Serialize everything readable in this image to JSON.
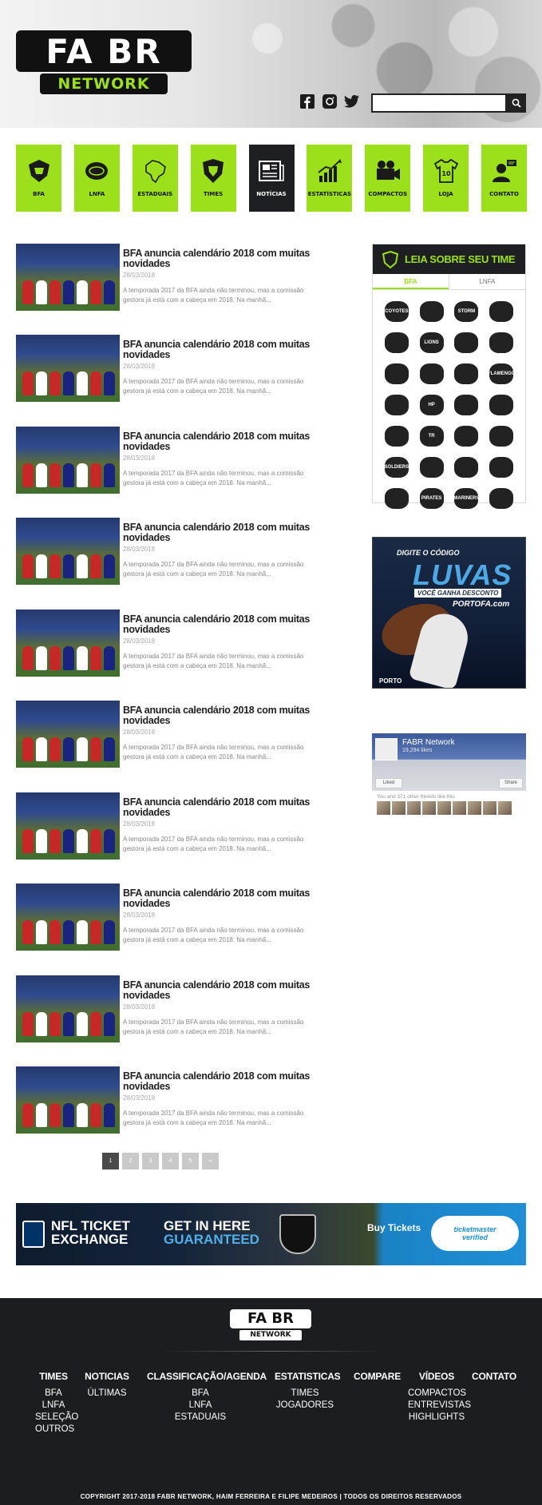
{
  "header": {
    "logo_top": "FA BR",
    "logo_bottom": "NETWORK",
    "search": {
      "value": "",
      "placeholder": ""
    },
    "social": [
      "facebook-icon",
      "instagram-icon",
      "twitter-icon"
    ]
  },
  "nav": [
    {
      "label": "BFA",
      "icon": "bfa-shield-icon"
    },
    {
      "label": "LNFA",
      "icon": "lnfa-helmet-icon"
    },
    {
      "label": "ESTADUAIS",
      "icon": "brazil-map-icon"
    },
    {
      "label": "TIMES",
      "icon": "team-shield-icon"
    },
    {
      "label": "NOTÍCIAS",
      "icon": "newspaper-icon",
      "active": true
    },
    {
      "label": "ESTATÍSTICAS",
      "icon": "bar-chart-icon"
    },
    {
      "label": "COMPACTOS",
      "icon": "video-camera-icon"
    },
    {
      "label": "LOJA",
      "icon": "jersey-icon"
    },
    {
      "label": "CONTATO",
      "icon": "contact-person-icon"
    }
  ],
  "news": [
    {
      "title": "BFA anuncia calendário 2018 com muitas novidades",
      "date": "28/03/2018",
      "excerpt": "A temporada 2017 da BFA ainda não terminou, mas a comissão gestora já está com a cabeça em 2018. Na manhã..."
    },
    {
      "title": "BFA anuncia calendário 2018 com muitas novidades",
      "date": "28/03/2018",
      "excerpt": "A temporada 2017 da BFA ainda não terminou, mas a comissão gestora já está com a cabeça em 2018. Na manhã..."
    },
    {
      "title": "BFA anuncia calendário 2018 com muitas novidades",
      "date": "28/03/2018",
      "excerpt": "A temporada 2017 da BFA ainda não terminou, mas a comissão gestora já está com a cabeça em 2018. Na manhã..."
    },
    {
      "title": "BFA anuncia calendário 2018 com muitas novidades",
      "date": "28/03/2018",
      "excerpt": "A temporada 2017 da BFA ainda não terminou, mas a comissão gestora já está com a cabeça em 2018. Na manhã..."
    },
    {
      "title": "BFA anuncia calendário 2018 com muitas novidades",
      "date": "28/03/2018",
      "excerpt": "A temporada 2017 da BFA ainda não terminou, mas a comissão gestora já está com a cabeça em 2018. Na manhã..."
    },
    {
      "title": "BFA anuncia calendário 2018 com muitas novidades",
      "date": "28/03/2018",
      "excerpt": "A temporada 2017 da BFA ainda não terminou, mas a comissão gestora já está com a cabeça em 2018. Na manhã..."
    },
    {
      "title": "BFA anuncia calendário 2018 com muitas novidades",
      "date": "28/03/2018",
      "excerpt": "A temporada 2017 da BFA ainda não terminou, mas a comissão gestora já está com a cabeça em 2018. Na manhã..."
    },
    {
      "title": "BFA anuncia calendário 2018 com muitas novidades",
      "date": "28/03/2018",
      "excerpt": "A temporada 2017 da BFA ainda não terminou, mas a comissão gestora já está com a cabeça em 2018. Na manhã..."
    },
    {
      "title": "BFA anuncia calendário 2018 com muitas novidades",
      "date": "28/03/2018",
      "excerpt": "A temporada 2017 da BFA ainda não terminou, mas a comissão gestora já está com a cabeça em 2018. Na manhã..."
    },
    {
      "title": "BFA anuncia calendário 2018 com muitas novidades",
      "date": "28/03/2018",
      "excerpt": "A temporada 2017 da BFA ainda não terminou, mas a comissão gestora já está com a cabeça em 2018. Na manhã..."
    }
  ],
  "pagination": {
    "pages": [
      "1",
      "2",
      "3",
      "4",
      "5",
      "»"
    ],
    "current": "1"
  },
  "sidebar": {
    "team_box": {
      "title": "LEIA SOBRE SEU TIME",
      "tabs": [
        "BFA",
        "LNFA"
      ],
      "active_tab": "BFA",
      "team_logos": [
        "COYOTES",
        "",
        "STORM",
        "",
        "",
        "LIONS",
        "",
        "",
        "",
        "",
        "",
        "FLAMENGO",
        "",
        "HP",
        "",
        "",
        "",
        "TR",
        "",
        "",
        "SOLDIERS",
        "",
        "",
        "",
        "",
        "PIRATES",
        "MARINERS",
        ""
      ]
    },
    "ad": {
      "line1": "DIGITE O CÓDIGO",
      "code": "LUVAS",
      "line2": "VOCÊ GANHA DESCONTO",
      "site": "PORTOFA.com",
      "brand": "PORTO"
    },
    "facebook": {
      "page_name": "FABR Network",
      "likes": "19,294 likes",
      "liked_label": "Liked",
      "share_label": "Share",
      "friends_text": "You and 371 other friends like this"
    }
  },
  "bottom_ad": {
    "left_line1": "NFL TICKET",
    "left_line2": "EXCHANGE",
    "mid_line1": "GET IN HERE",
    "mid_line2": "GUARANTEED",
    "button": "Buy Tickets",
    "badge_line1": "ticketmaster",
    "badge_line2": "verified"
  },
  "footer": {
    "logo_top": "FA BR",
    "logo_bottom": "NETWORK",
    "columns": [
      {
        "heading": "TIMES",
        "items": [
          "BFA",
          "LNFA",
          "SELEÇÃO",
          "OUTROS"
        ]
      },
      {
        "heading": "NOTICIAS",
        "items": [
          "ÚLTIMAS"
        ]
      },
      {
        "heading": "CLASSIFICAÇÃO/AGENDA",
        "items": [
          "BFA",
          "LNFA",
          "ESTADUAIS"
        ]
      },
      {
        "heading": "ESTATISTICAS",
        "items": [
          "TIMES",
          "JOGADORES"
        ]
      },
      {
        "heading": "COMPARE",
        "items": []
      },
      {
        "heading": "VÍDEOS",
        "items": [
          "COMPACTOS",
          "ENTREVISTAS",
          "HIGHLIGHTS"
        ]
      },
      {
        "heading": "CONTATO",
        "items": []
      }
    ],
    "copyright": "COPYRIGHT 2017-2018 FABR NETWORK, HAIM FERREIRA E FILIPE MEDEIROS | TODOS OS DIREITOS RESERVADOS"
  },
  "colors": {
    "accent": "#9be01a",
    "dark": "#1c1d20"
  }
}
